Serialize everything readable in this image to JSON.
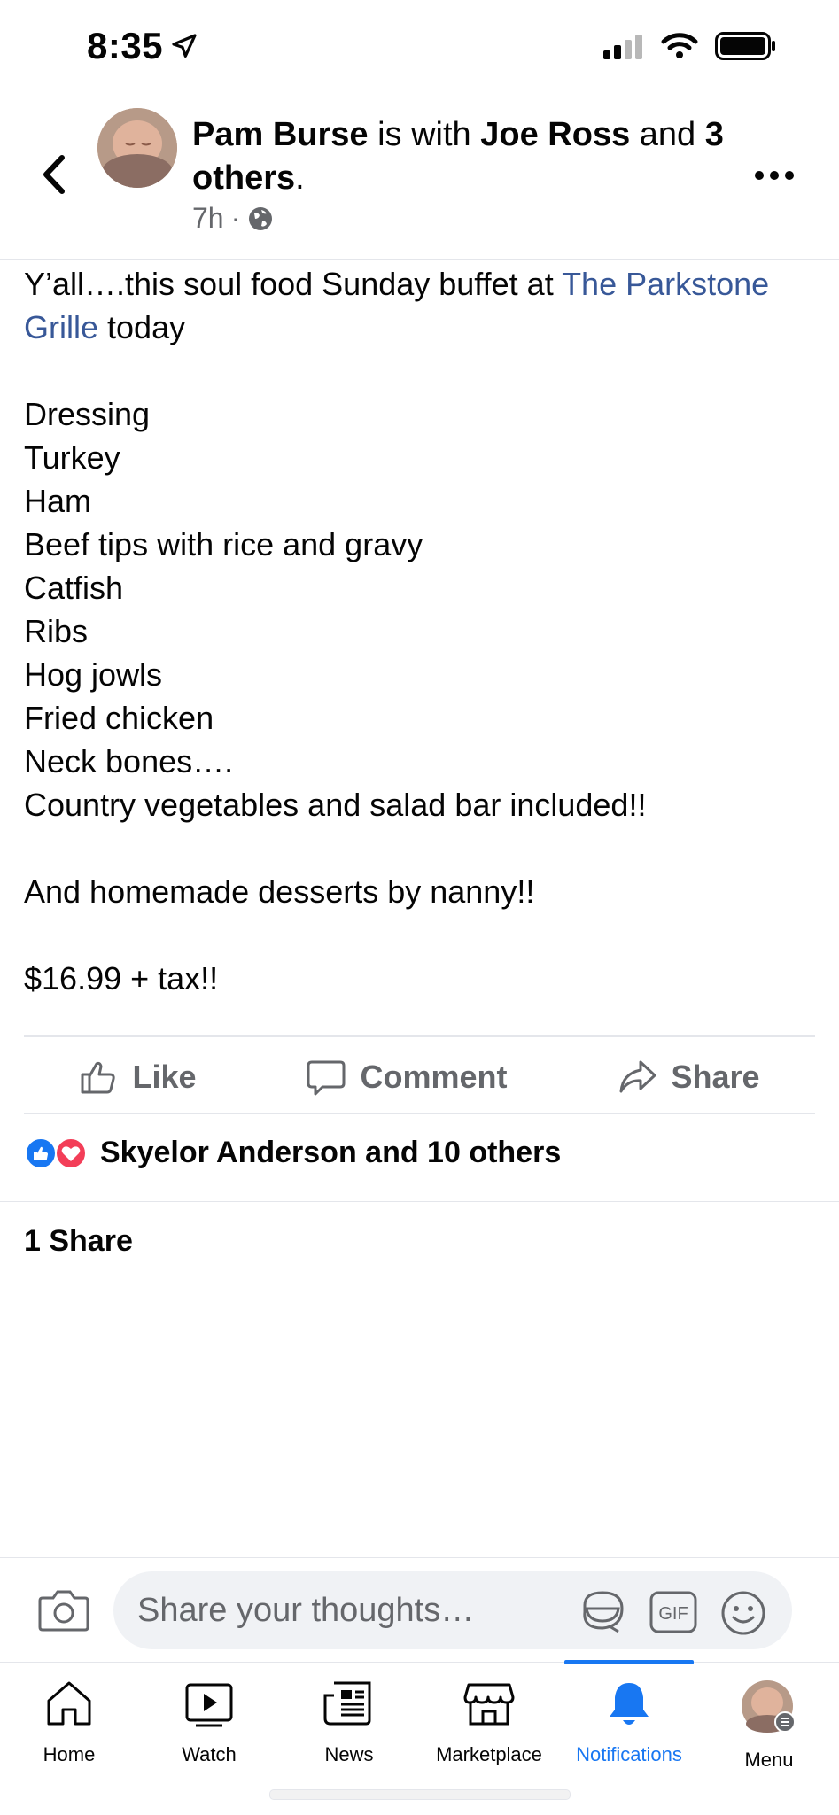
{
  "status_bar": {
    "time": "8:35"
  },
  "header": {
    "author": "Pam Burse",
    "with_text": "is with",
    "tagged": "Joe Ross",
    "and_text": "and",
    "others": "3 others",
    "time": "7h",
    "separator": "·"
  },
  "post": {
    "line1_prefix": "Y’all….this soul food Sunday buffet at ",
    "place_link": "The Parkstone Grille",
    "line1_suffix": " today",
    "body": "Dressing\nTurkey\nHam\nBeef tips with rice and gravy\nCatfish\nRibs\nHog jowls\nFried chicken\nNeck bones….\nCountry vegetables and salad bar included!!\n\nAnd homemade desserts by nanny!!\n\n$16.99 + tax!!"
  },
  "actions": {
    "like": "Like",
    "comment": "Comment",
    "share": "Share"
  },
  "reactions": {
    "summary": "Skyelor Anderson and 10 others"
  },
  "shares": {
    "count": "1 Share"
  },
  "composer": {
    "placeholder": "Share your thoughts…"
  },
  "tabs": [
    {
      "label": "Home",
      "icon": "home-icon"
    },
    {
      "label": "Watch",
      "icon": "watch-icon"
    },
    {
      "label": "News",
      "icon": "news-icon"
    },
    {
      "label": "Marketplace",
      "icon": "marketplace-icon"
    },
    {
      "label": "Notifications",
      "icon": "bell-icon",
      "active": true
    },
    {
      "label": "Menu",
      "icon": "avatar"
    }
  ],
  "colors": {
    "link": "#385898",
    "active": "#1877f2",
    "like_blue": "#1877f2",
    "love_red": "#f33e58",
    "secondary": "#65676b"
  }
}
